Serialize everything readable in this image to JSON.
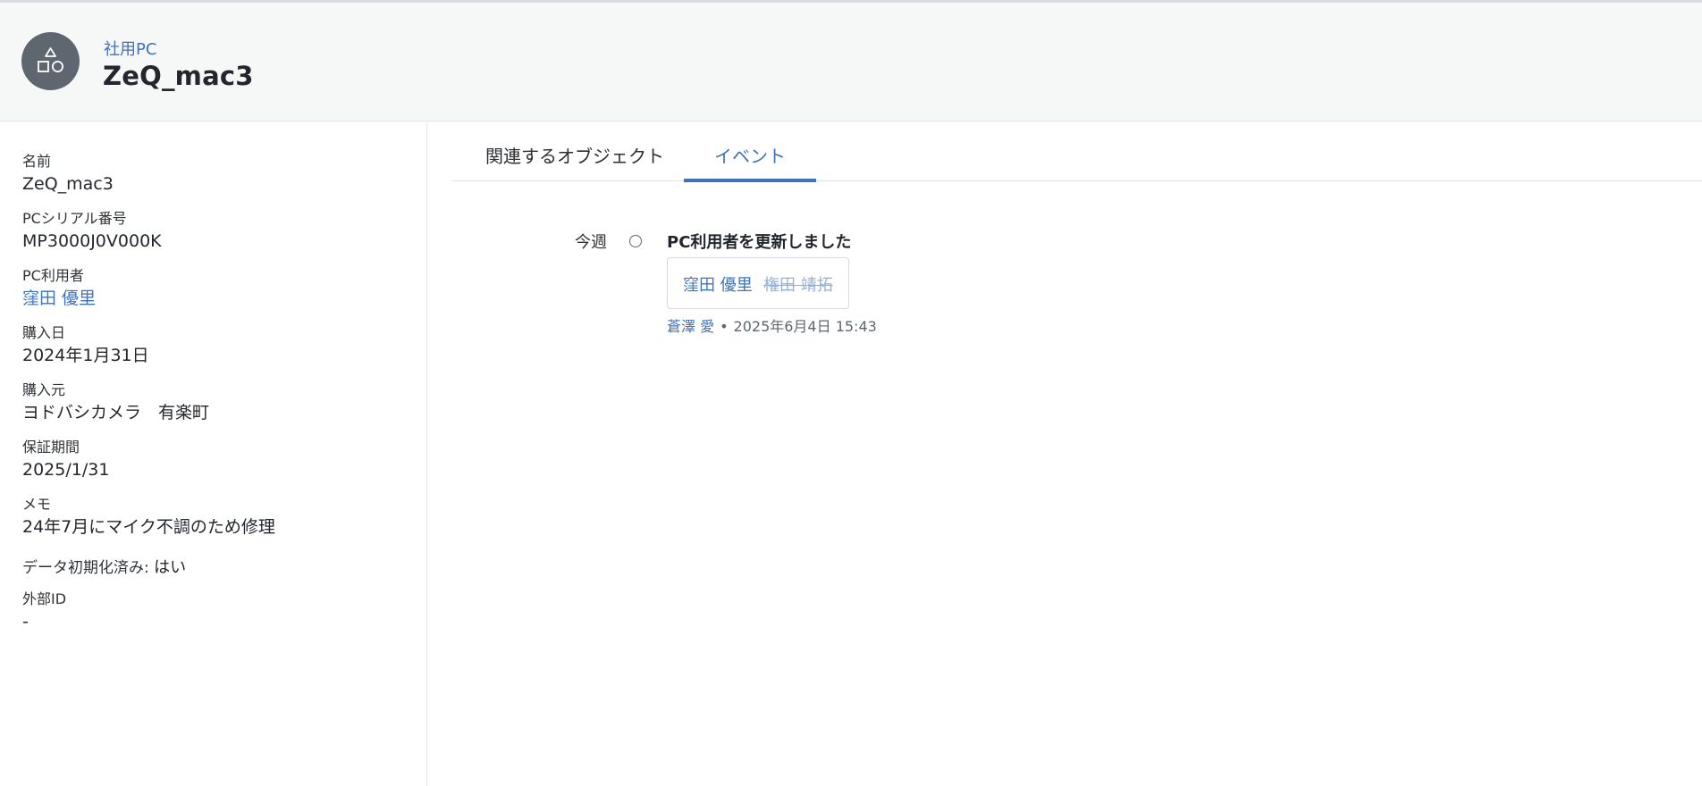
{
  "header": {
    "object_type": "社用PC",
    "title": "ZeQ_mac3",
    "avatar_icon": "shapes-icon"
  },
  "fields": {
    "name": {
      "label": "名前",
      "value": "ZeQ_mac3"
    },
    "serial": {
      "label": "PCシリアル番号",
      "value": "MP3000J0V000K"
    },
    "user": {
      "label": "PC利用者",
      "value": "窪田 優里"
    },
    "purchase_date": {
      "label": "購入日",
      "value": "2024年1月31日"
    },
    "vendor": {
      "label": "購入元",
      "value": "ヨドバシカメラ　有楽町"
    },
    "warranty": {
      "label": "保証期間",
      "value": "2025/1/31"
    },
    "memo": {
      "label": "メモ",
      "value": "24年7月にマイク不調のため修理"
    },
    "data_wiped": {
      "label": "データ初期化済み:",
      "value": "はい"
    },
    "external_id": {
      "label": "外部ID",
      "value": "-"
    }
  },
  "tabs": [
    {
      "label": "関連するオブジェクト",
      "active": false
    },
    {
      "label": "イベント",
      "active": true
    }
  ],
  "events": {
    "period": "今週",
    "items": [
      {
        "title": "PC利用者を更新しました",
        "new_value": "窪田 優里",
        "old_value": "権田 靖拓",
        "actor": "蒼澤 愛",
        "separator": "•",
        "timestamp": "2025年6月4日 15:43"
      }
    ]
  },
  "colors": {
    "accent": "#3d73b9",
    "header_bg": "#f6f7f7",
    "avatar_bg": "#5e666f"
  }
}
